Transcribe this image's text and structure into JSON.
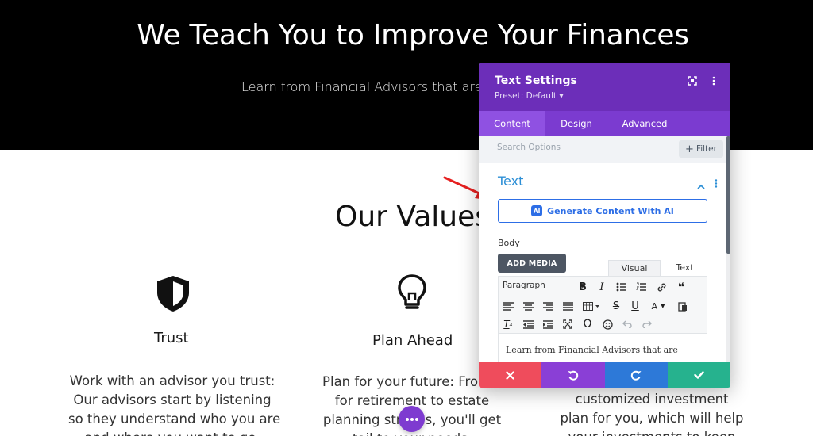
{
  "hero": {
    "title": "We Teach You to Improve Your Finances",
    "subtitle": "Learn from Financial Advisors that are"
  },
  "values": {
    "title": "Our Values",
    "items": [
      {
        "name": "Trust",
        "icon": "shield-icon",
        "lines": [
          "Work with an advisor you trust:",
          "Our advisors start by listening",
          "so they understand who you are",
          "and where you want to go."
        ]
      },
      {
        "name": "Plan Ahead",
        "icon": "lightbulb-icon",
        "lines": [
          "Plan for your future: From s",
          "for retirement to estate",
          "planning stra   ies, you'll get",
          "tail        to your needs."
        ]
      },
      {
        "name": "",
        "icon": "",
        "lines": [
          "customized investment",
          "plan for you, which will help",
          "your investments to keep"
        ]
      }
    ]
  },
  "panel": {
    "title": "Text Settings",
    "preset": "Preset: Default",
    "tabs": [
      "Content",
      "Design",
      "Advanced"
    ],
    "active_tab": "Content",
    "search_placeholder": "Search Options",
    "filter_label": "Filter",
    "section_title": "Text",
    "generate_label": "Generate Content With AI",
    "ai_badge": "AI",
    "body_label": "Body",
    "add_media_label": "ADD MEDIA",
    "mode_tabs": [
      "Visual",
      "Text"
    ],
    "format_select": "Paragraph",
    "editor_text": "Learn from Financial Advisors that are"
  },
  "colors": {
    "panel_header": "#6c2eb9",
    "tab_bar": "#7b3bd0",
    "accent_blue": "#2d6ee6",
    "cancel": "#ef4c5c",
    "undo": "#8a3fd6",
    "redo": "#2d79d8",
    "save": "#26b28e"
  }
}
